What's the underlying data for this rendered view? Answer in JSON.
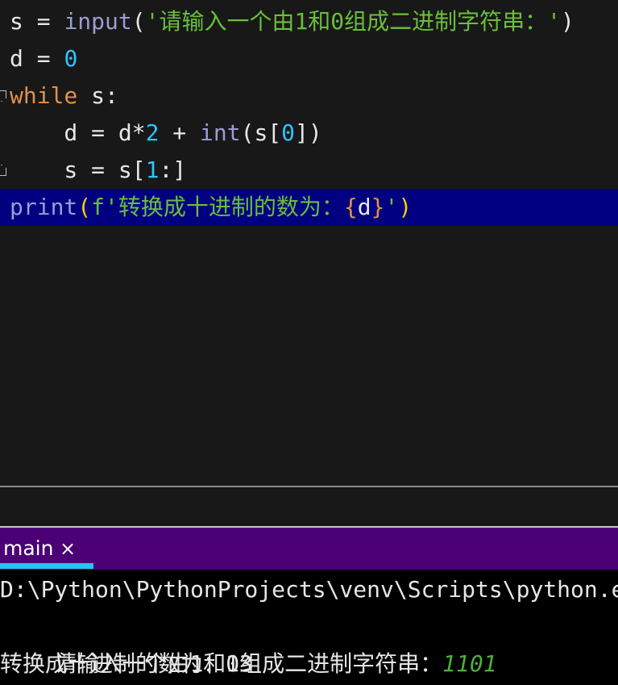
{
  "editor": {
    "lines": [
      {
        "tokens": [
          {
            "t": "s",
            "c": "id"
          },
          {
            "t": " = ",
            "c": "op"
          },
          {
            "t": "input",
            "c": "bi"
          },
          {
            "t": "(",
            "c": "id"
          },
          {
            "t": "'请输入一个由1和0组成二进制字符串：'",
            "c": "str"
          },
          {
            "t": ")",
            "c": "id"
          }
        ]
      },
      {
        "tokens": [
          {
            "t": "d",
            "c": "id"
          },
          {
            "t": " = ",
            "c": "op"
          },
          {
            "t": "0",
            "c": "num"
          }
        ]
      },
      {
        "fold": "open",
        "tokens": [
          {
            "t": "while",
            "c": "kw"
          },
          {
            "t": " s:",
            "c": "id"
          }
        ]
      },
      {
        "tokens": [
          {
            "t": "    d = d*",
            "c": "id"
          },
          {
            "t": "2",
            "c": "num"
          },
          {
            "t": " + ",
            "c": "op"
          },
          {
            "t": "int",
            "c": "bi"
          },
          {
            "t": "(s[",
            "c": "id"
          },
          {
            "t": "0",
            "c": "num"
          },
          {
            "t": "])",
            "c": "id"
          }
        ]
      },
      {
        "fold": "end",
        "tokens": [
          {
            "t": "    s = s[",
            "c": "id"
          },
          {
            "t": "1",
            "c": "num"
          },
          {
            "t": ":]",
            "c": "id"
          }
        ]
      },
      {
        "highlighted": true,
        "tokens": [
          {
            "t": "print",
            "c": "bi"
          },
          {
            "t": "(",
            "c": "paren"
          },
          {
            "t": "f'转换成十进制的数为：",
            "c": "str"
          },
          {
            "t": "{",
            "c": "brace"
          },
          {
            "t": "d",
            "c": "id"
          },
          {
            "t": "}",
            "c": "brace"
          },
          {
            "t": "'",
            "c": "str"
          },
          {
            "t": ")",
            "c": "paren"
          }
        ]
      }
    ]
  },
  "run_panel": {
    "tab_label": "main",
    "close_glyph": "×",
    "colors": {
      "tab_bar": "#4b0075",
      "tab_underline": "#22c6ee",
      "console_bg": "#000000",
      "input_text": "#4caf3a"
    }
  },
  "console": {
    "command": "D:\\Python\\PythonProjects\\venv\\Scripts\\python.exe",
    "prompt_text": "请输入一个由1和0组成二进制字符串：",
    "user_input": "1101",
    "result_text": "转换成十进制的数为：13"
  },
  "theme": {
    "editor_bg": "#181818",
    "current_line_bg": "#000080",
    "keyword": "#e2914a",
    "builtin": "#9b9bd6",
    "number": "#2ec4ff",
    "string": "#6abf3a",
    "paren_highlight": "#f5d100"
  }
}
